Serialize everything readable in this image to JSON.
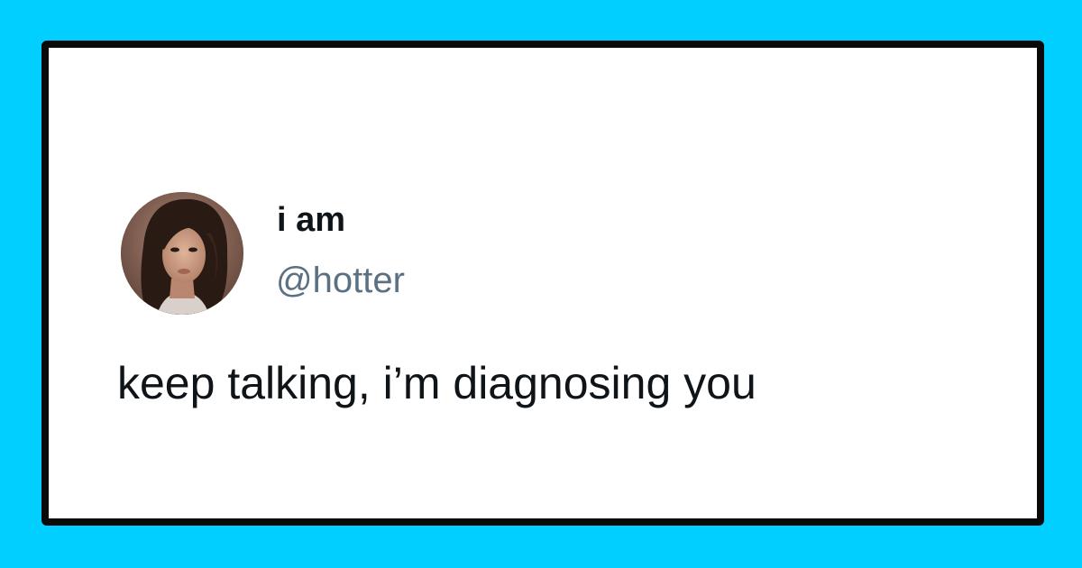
{
  "colors": {
    "background": "#00cfff",
    "card": "#ffffff",
    "border": "#0a0a0a",
    "name_text": "#0f1419",
    "handle_text": "#5b7083"
  },
  "tweet": {
    "display_name": "i am",
    "handle": "@hotter",
    "text": "keep talking, i’m diagnosing you",
    "avatar_icon": "profile-photo"
  }
}
